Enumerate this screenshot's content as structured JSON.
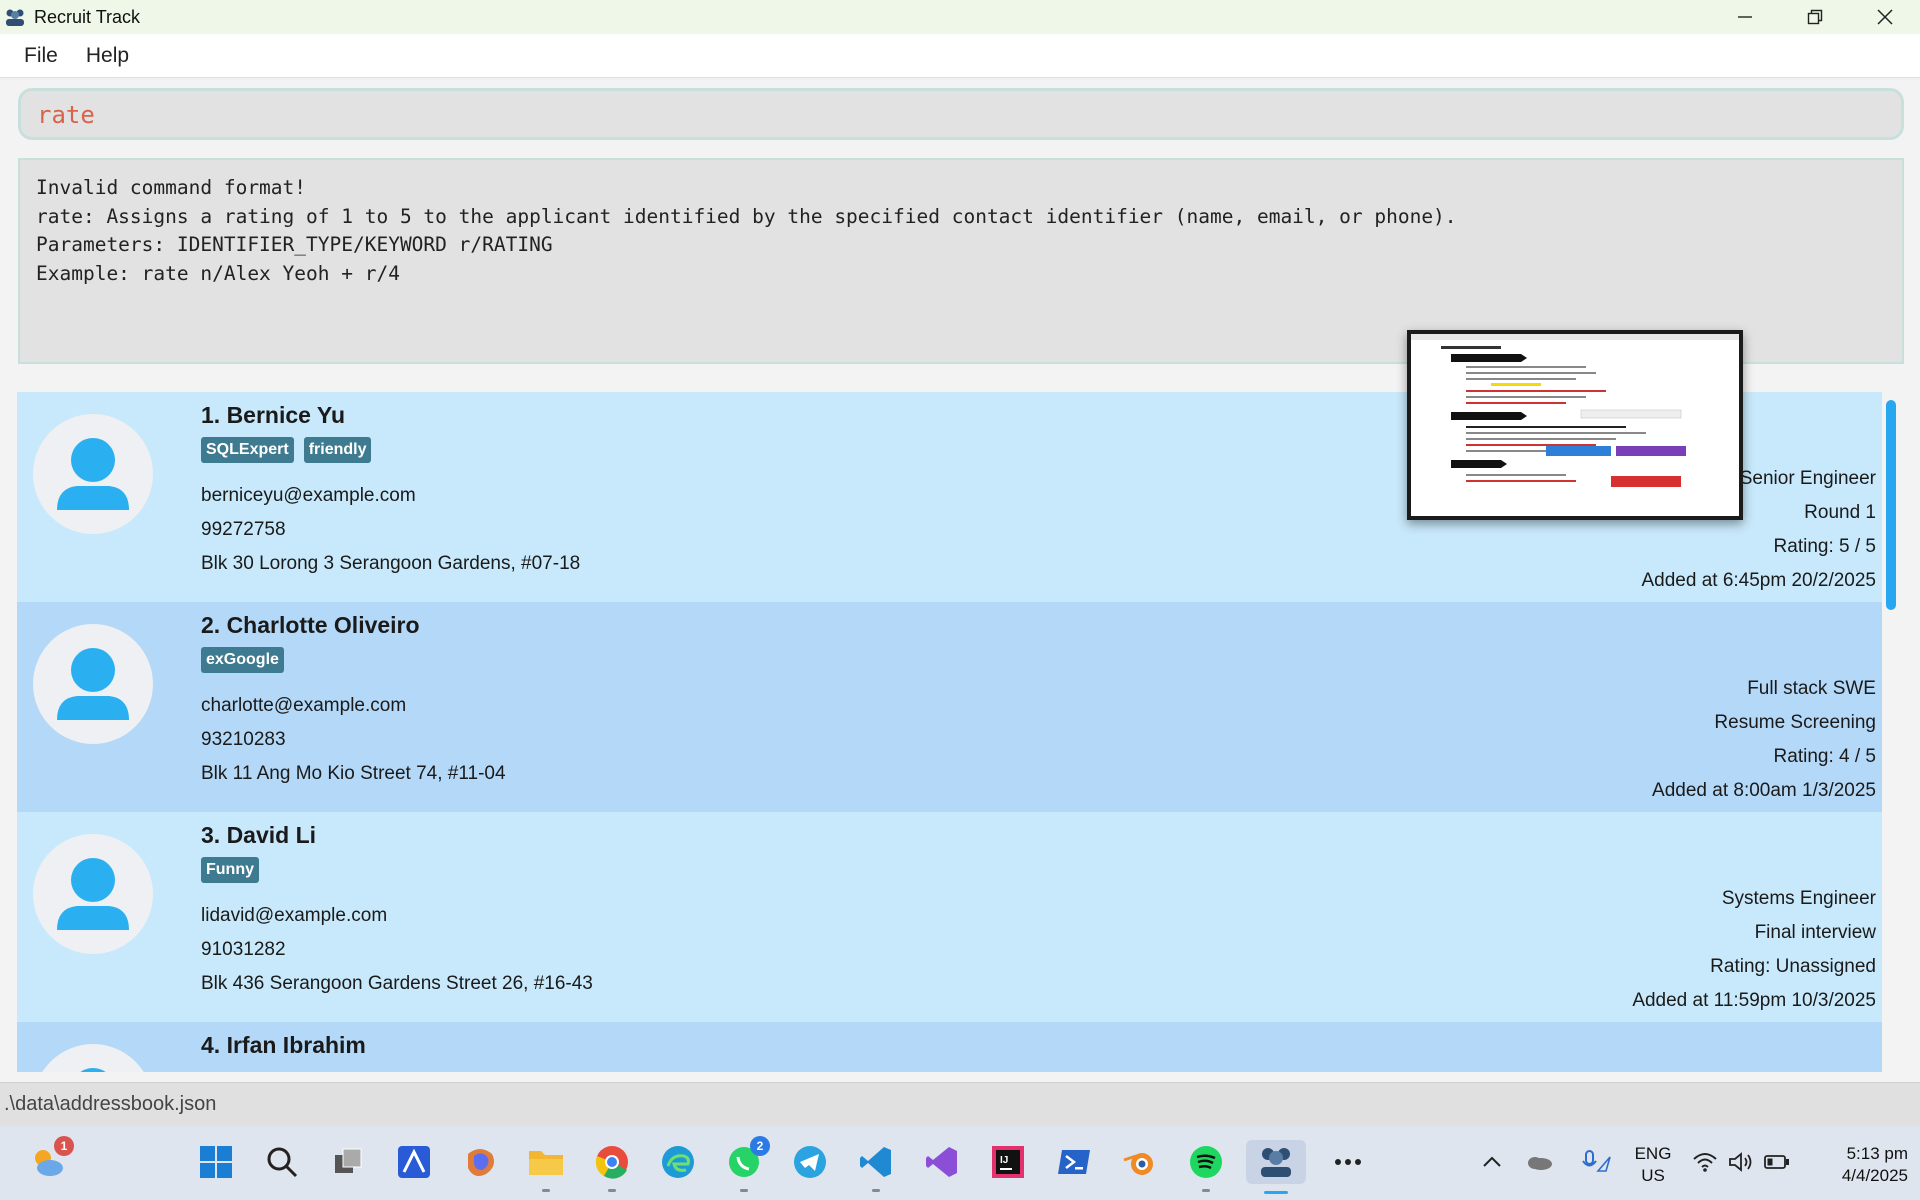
{
  "window": {
    "title": "Recruit Track"
  },
  "menu": {
    "file": "File",
    "help": "Help"
  },
  "command": {
    "value": "rate"
  },
  "result": {
    "lines": [
      "Invalid command format!",
      "rate: Assigns a rating of 1 to 5 to the applicant identified by the specified contact identifier (name, email, or phone).",
      "Parameters: IDENTIFIER_TYPE/KEYWORD r/RATING",
      "Example: rate n/Alex Yeoh + r/4"
    ]
  },
  "applicants": [
    {
      "name": "1. Bernice Yu",
      "tags": [
        "SQLExpert",
        "friendly"
      ],
      "email": "berniceyu@example.com",
      "phone": "99272758",
      "address": "Blk 30 Lorong 3 Serangoon Gardens, #07-18",
      "job": "Senior Engineer",
      "stage": "Round 1",
      "rating": "Rating: 5 / 5",
      "added": "Added at 6:45pm 20/2/2025"
    },
    {
      "name": "2. Charlotte Oliveiro",
      "tags": [
        "exGoogle"
      ],
      "email": "charlotte@example.com",
      "phone": "93210283",
      "address": "Blk 11 Ang Mo Kio Street 74, #11-04",
      "job": "Full stack SWE",
      "stage": "Resume Screening",
      "rating": "Rating: 4 / 5",
      "added": "Added at 8:00am 1/3/2025"
    },
    {
      "name": "3. David Li",
      "tags": [
        "Funny"
      ],
      "email": "lidavid@example.com",
      "phone": "91031282",
      "address": "Blk 436 Serangoon Gardens Street 26, #16-43",
      "job": "Systems Engineer",
      "stage": "Final interview",
      "rating": "Rating: Unassigned",
      "added": "Added at 11:59pm 10/3/2025"
    },
    {
      "name": "4. Irfan Ibrahim"
    }
  ],
  "status": {
    "path": ".\\data\\addressbook.json"
  },
  "taskbar": {
    "weather_badge": "1",
    "whatsapp_badge": "2",
    "lang_line1": "ENG",
    "lang_line2": "US",
    "time": "5:13 pm",
    "date": "4/4/2025",
    "colors": {
      "accent": "#27a7ef",
      "card_odd": "#c8e9fb",
      "card_even": "#b4d8f7",
      "tag": "#3e7b91",
      "command_text": "#d9634a"
    }
  }
}
